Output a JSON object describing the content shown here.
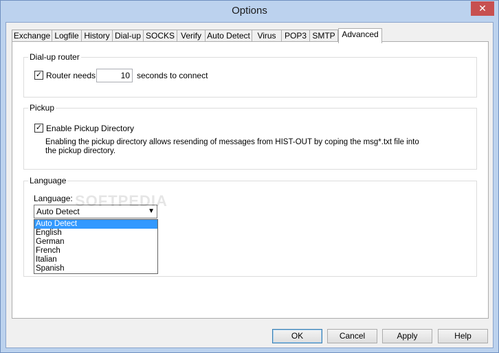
{
  "window": {
    "title": "Options",
    "close_glyph": "✕"
  },
  "tabs": [
    {
      "label": "Exchange"
    },
    {
      "label": "Logfile"
    },
    {
      "label": "History"
    },
    {
      "label": "Dial-up"
    },
    {
      "label": "SOCKS"
    },
    {
      "label": "Verify"
    },
    {
      "label": "Auto Detect"
    },
    {
      "label": "Virus"
    },
    {
      "label": "POP3"
    },
    {
      "label": "SMTP"
    },
    {
      "label": "Advanced",
      "active": true
    }
  ],
  "dialup_router": {
    "group_title": "Dial-up router",
    "router_needs_label": "Router needs",
    "router_needs_checked": true,
    "seconds_value": "10",
    "seconds_suffix": "seconds to connect"
  },
  "pickup": {
    "group_title": "Pickup",
    "enable_label": "Enable Pickup Directory",
    "enable_checked": true,
    "description": "Enabling the pickup directory allows resending of messages from HIST-OUT by coping the msg*.txt file into the pickup directory."
  },
  "language": {
    "group_title": "Language",
    "field_label": "Language:",
    "selected": "Auto Detect",
    "options": [
      "Auto Detect",
      "English",
      "German",
      "French",
      "Italian",
      "Spanish"
    ]
  },
  "watermark": "SOFTPEDIA",
  "buttons": {
    "ok": "OK",
    "cancel": "Cancel",
    "apply": "Apply",
    "help": "Help"
  },
  "icons": {
    "checkmark": "✓",
    "dropdown_arrow": "▼"
  },
  "colors": {
    "titlebar": "#bcd2ee",
    "close": "#c75050",
    "selection": "#3399ff"
  }
}
